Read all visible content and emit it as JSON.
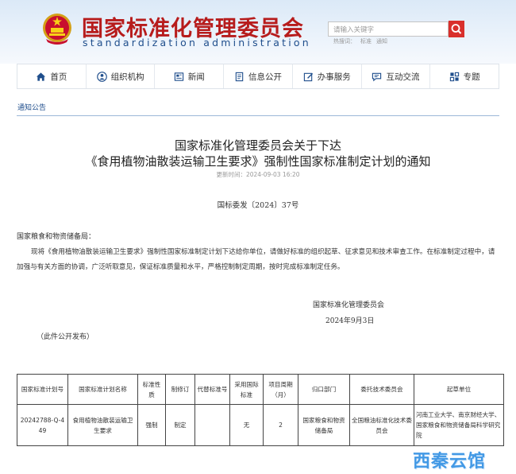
{
  "header": {
    "title_cn": "国家标准化管理委员会",
    "title_en": "standardization administration",
    "search_placeholder": "请输入关键字",
    "hot_words_label": "热搜词：",
    "hot_words": [
      "标准",
      "通知"
    ]
  },
  "nav": {
    "items": [
      {
        "label": "首页",
        "icon": "home-icon"
      },
      {
        "label": "组织机构",
        "icon": "org-icon"
      },
      {
        "label": "新闻",
        "icon": "news-icon"
      },
      {
        "label": "信息公开",
        "icon": "info-icon"
      },
      {
        "label": "办事服务",
        "icon": "service-icon"
      },
      {
        "label": "互动交流",
        "icon": "chat-icon"
      },
      {
        "label": "专题",
        "icon": "topic-icon"
      }
    ]
  },
  "breadcrumb": "通知公告",
  "article": {
    "title_line1": "国家标准化管理委员会关于下达",
    "title_line2": "《食用植物油散装运输卫生要求》强制性国家标准制定计划的通知",
    "update_time": "更新时间：2024-09-03 16:20",
    "doc_number": "国标委发〔2024〕37号",
    "addressee": "国家粮食和物资储备局：",
    "body": "现将《食用植物油散装运输卫生要求》强制性国家标准制定计划下达给你单位，请做好标准的组织起草、征求意见和技术审查工作。在标准制定过程中，请加强与有关方面的协调，广泛听取意见，保证标准质量和水平，严格控制制定周期，按时完成标准制定任务。",
    "signer": "国家标准化管理委员会",
    "sign_date": "2024年9月3日",
    "public_note": "（此件公开发布）"
  },
  "table": {
    "headers": [
      "国家标准计划号",
      "国家标准计划名称",
      "标准性质",
      "制修订",
      "代替标准号",
      "采用国际标准",
      "项目周期（月）",
      "归口部门",
      "委托技术委员会",
      "起草单位"
    ],
    "rows": [
      [
        "20242788-Q-449",
        "食用植物油散装运输卫生要求",
        "强制",
        "制定",
        "",
        "无",
        "2",
        "国家粮食和物资储备局",
        "全国粮油标准化技术委员会",
        "河南工业大学、南京财经大学、国家粮食和物资储备局科学研究院"
      ]
    ]
  },
  "watermark": "西秦云馆",
  "colors": {
    "title_red": "#b71c1c",
    "link_blue": "#1f4e8c",
    "search_red": "#d9302c"
  }
}
